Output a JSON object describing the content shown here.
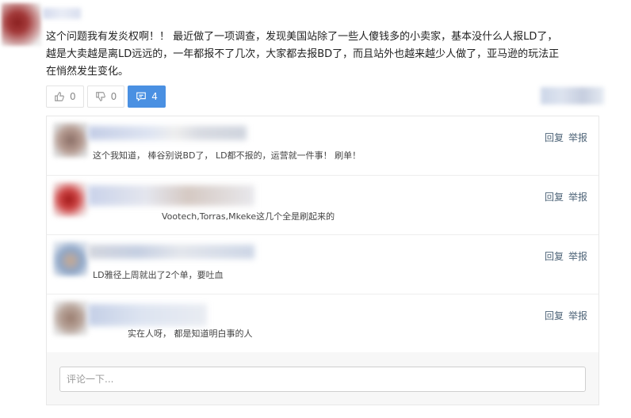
{
  "post": {
    "lines": [
      "这个问题我有发炎权啊！！ 最近做了一项调查，发现美国站除了一些人傻钱多的小卖家，基本没什么人报LD了，",
      "越是大卖越是离LD远远的，一年都报不了几次，大家都去报BD了，而且站外也越来越少人做了，亚马逊的玩法正",
      "在悄然发生变化。"
    ]
  },
  "votes": {
    "up_count": "0",
    "down_count": "0",
    "comment_count": "4",
    "up_icon": "thumbs-up-icon",
    "down_icon": "thumbs-down-icon",
    "comment_icon": "comment-icon",
    "accent_color": "#4a90e2"
  },
  "comments": [
    {
      "text": "这个我知道， 棒谷别说BD了， LD都不报的，运营就一件事！ 刷单！",
      "reply": "回复",
      "report": "举报"
    },
    {
      "text": "Vootech,Torras,Mkeke这几个全是刷起来的",
      "reply": "回复",
      "report": "举报"
    },
    {
      "text": "LD雅径上周就出了2个单，要吐血",
      "reply": "回复",
      "report": "举报"
    },
    {
      "text": "实在人呀， 都是知道明白事的人",
      "reply": "回复",
      "report": "举报"
    }
  ],
  "comment_input": {
    "placeholder": "评论一下..."
  }
}
